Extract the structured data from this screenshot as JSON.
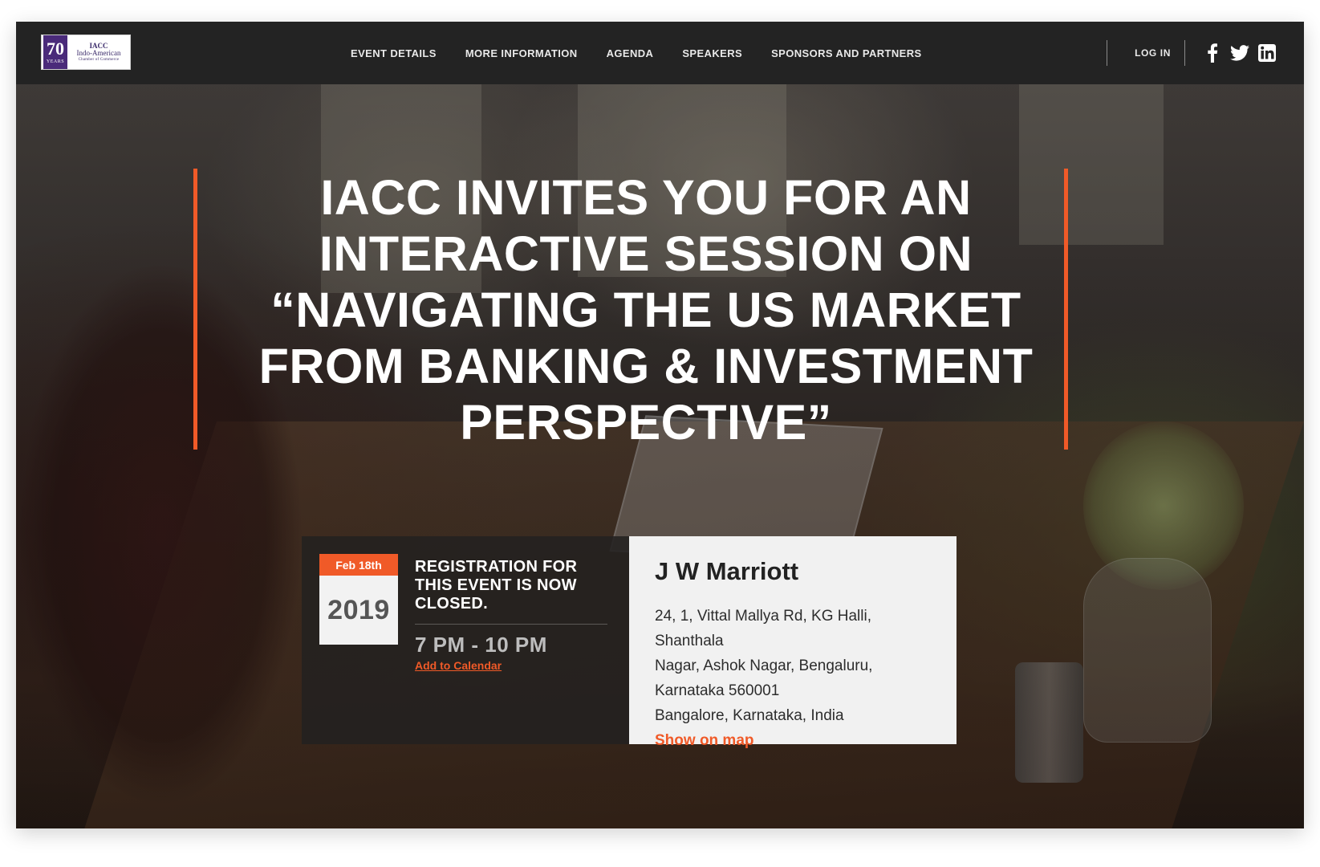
{
  "logo": {
    "badge_number": "70",
    "badge_sub": "YEARS",
    "line1": "IACC",
    "line2": "Indo-American",
    "line3": "Chamber of Commerce"
  },
  "nav": {
    "items": [
      {
        "label": "EVENT DETAILS"
      },
      {
        "label": "MORE INFORMATION"
      },
      {
        "label": "AGENDA"
      },
      {
        "label": "SPEAKERS"
      },
      {
        "label": "SPONSORS AND PARTNERS"
      }
    ],
    "login_label": "LOG IN",
    "social_icons": [
      "facebook-icon",
      "twitter-icon",
      "linkedin-icon"
    ]
  },
  "hero": {
    "headline": "IACC INVITES YOU FOR AN INTERACTIVE SESSION ON “NAVIGATING THE US MARKET FROM BANKING & INVESTMENT PERSPECTIVE”"
  },
  "event": {
    "date_label": "Feb 18th",
    "year": "2019",
    "registration_status": "REGISTRATION FOR THIS EVENT IS NOW CLOSED.",
    "time": "7 PM - 10 PM",
    "add_to_calendar": "Add to Calendar"
  },
  "venue": {
    "name": "J W Marriott",
    "address_line1": "24, 1, Vittal Mallya Rd, KG Halli, Shanthala",
    "address_line2": "Nagar, Ashok Nagar, Bengaluru,",
    "address_line3": "Karnataka 560001",
    "address_line4": "Bangalore, Karnataka, India",
    "map_link": "Show on map"
  },
  "colors": {
    "accent": "#f05a28",
    "nav_background": "#232323",
    "venue_panel": "#f1f1f1"
  }
}
